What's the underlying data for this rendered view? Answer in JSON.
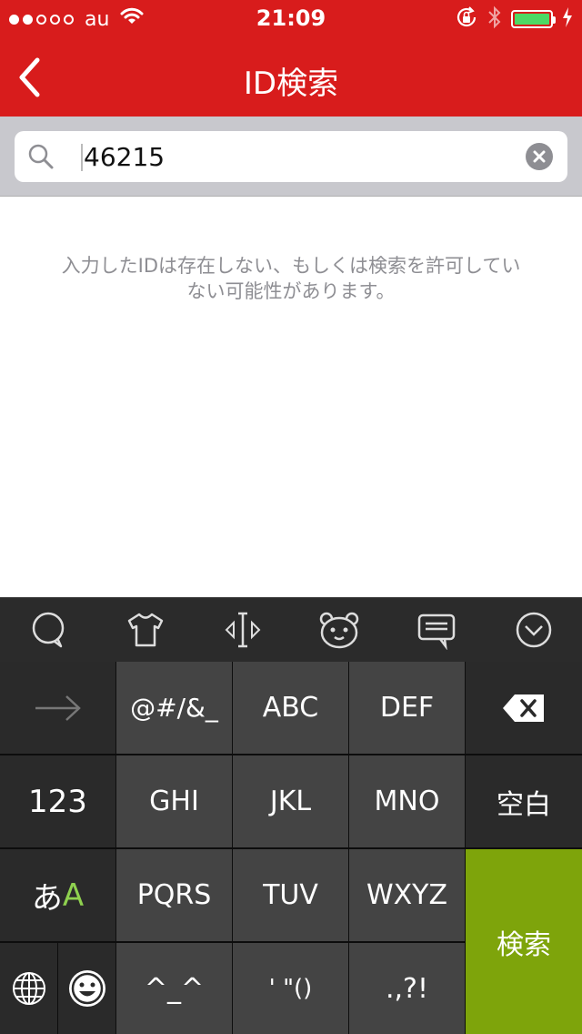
{
  "status": {
    "carrier": "au",
    "time": "21:09",
    "signal_filled": 2,
    "signal_total": 5,
    "battery_level": 1.0,
    "battery_color": "#4cd964"
  },
  "nav": {
    "title": "ID検索",
    "bar_color": "#d81c1c"
  },
  "search": {
    "value": "46215"
  },
  "message": {
    "line1": "入力したIDは存在しない、もしくは検索を許可してい",
    "line2": "ない可能性があります。"
  },
  "keyboard_toolbar": {
    "icons": [
      "speech-bubble-icon",
      "tshirt-icon",
      "cursor-move-icon",
      "bear-face-icon",
      "message-icon",
      "dismiss-keyboard-icon"
    ]
  },
  "keyboard": {
    "keys": {
      "arrow": "→",
      "symbols": "@#/&_",
      "abc": "ABC",
      "def": "DEF",
      "num": "123",
      "ghi": "GHI",
      "jkl": "JKL",
      "mno": "MNO",
      "space": "空白",
      "kana": "あ",
      "alpha": "A",
      "pqrs": "PQRS",
      "tuv": "TUV",
      "wxyz": "WXYZ",
      "search": "検索",
      "caret_face": "^_^",
      "quotes": "' \"()",
      "punct": ".,?!"
    },
    "green_color": "#7ea40b"
  }
}
